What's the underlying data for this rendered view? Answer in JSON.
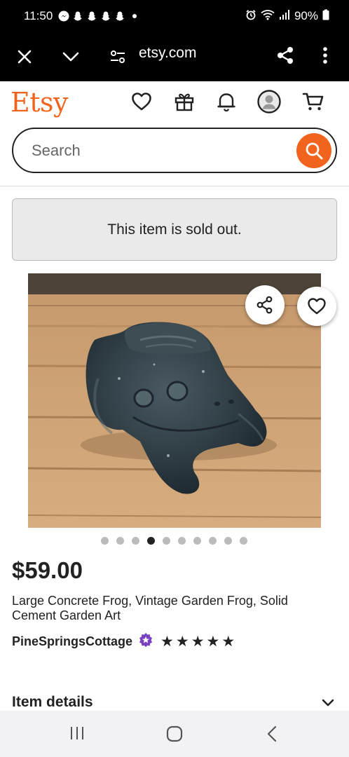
{
  "status_bar": {
    "time": "11:50",
    "battery": "90%",
    "icons": [
      "messenger-icon",
      "snapchat-icon",
      "snapchat-icon",
      "snapchat-icon",
      "snapchat-icon",
      "dot-icon",
      "alarm-icon",
      "wifi-icon",
      "signal-icon",
      "battery-icon"
    ]
  },
  "browser": {
    "url": "etsy.com",
    "icons": [
      "close-icon",
      "chevron-down-icon",
      "site-settings-icon",
      "share-icon",
      "more-vert-icon"
    ]
  },
  "header": {
    "logo": "Etsy",
    "brand_color": "#f1641e",
    "icons": [
      "heart-icon",
      "gift-icon",
      "bell-icon",
      "avatar-icon",
      "cart-icon"
    ]
  },
  "search": {
    "placeholder": "Search"
  },
  "notice": {
    "text": "This item is sold out."
  },
  "gallery": {
    "image_alt": "Dark grey concrete frog statue on a wooden deck",
    "total_images": 10,
    "active_index": 3
  },
  "product": {
    "price": "$59.00",
    "title": "Large Concrete Frog, Vintage Garden Frog, Solid Cement Garden Art",
    "shop_name": "PineSpringsCottage",
    "rating": 5
  },
  "details": {
    "label": "Item details"
  },
  "nav": {
    "icons": [
      "recent-apps-icon",
      "home-icon",
      "back-icon"
    ]
  }
}
